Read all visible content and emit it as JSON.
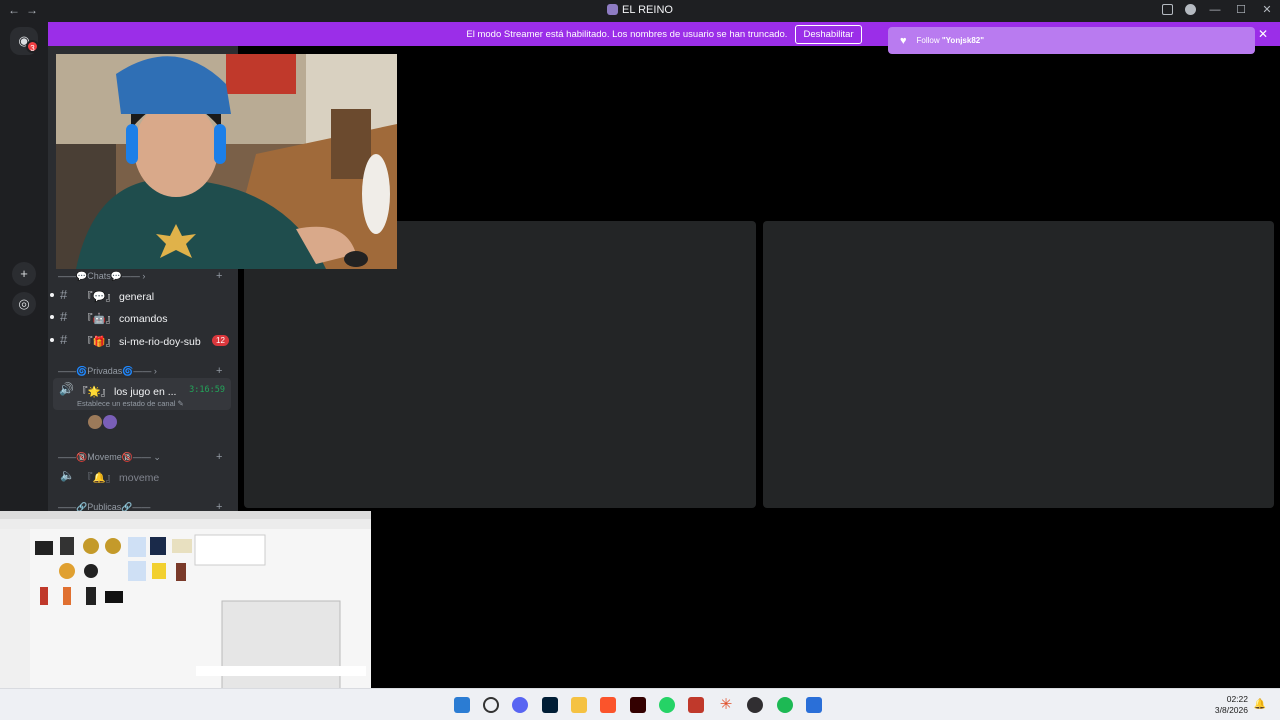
{
  "window": {
    "title": "EL REINO",
    "nav_back": "←",
    "nav_forward": "→",
    "min": "—",
    "max": "☐",
    "close": "✕"
  },
  "banner": {
    "text": "El modo Streamer está habilitado. Los nombres de usuario se han truncado.",
    "button": "Deshabilitar",
    "close": "✕"
  },
  "notification": {
    "prefix": "Follow",
    "user": "\"Yonjsk82\""
  },
  "guilds": {
    "home_badge": "3"
  },
  "sidebar": {
    "categories": [
      {
        "label": "——💬Chats💬—— ›"
      },
      {
        "label": "——🌀Privadas🌀—— ›"
      },
      {
        "label": "——🔞Moveme🔞—— ⌄"
      },
      {
        "label": "——🔗Publicas🔗——"
      }
    ],
    "channels": [
      {
        "prefix": "『💬』",
        "name": "general"
      },
      {
        "prefix": "『🤖』",
        "name": "comandos"
      },
      {
        "prefix": "『🎁』",
        "name": "si-me-rio-doy-sub",
        "count": "12"
      }
    ],
    "active_voice": {
      "prefix": "『🌟』",
      "name": "los jugo en ...",
      "time": "3:16:59",
      "status": "Establece un estado de canal ✎"
    },
    "voice2": {
      "prefix": "『🔔』",
      "name": "moveme"
    }
  },
  "taskbar": {
    "time": "02:22",
    "date": "3/8/2026"
  },
  "colors": {
    "streamer_banner": "#9b2ee8",
    "follow_alert": "#b97bf0",
    "voice_green": "#23a55a",
    "badge_red": "#da373c"
  }
}
